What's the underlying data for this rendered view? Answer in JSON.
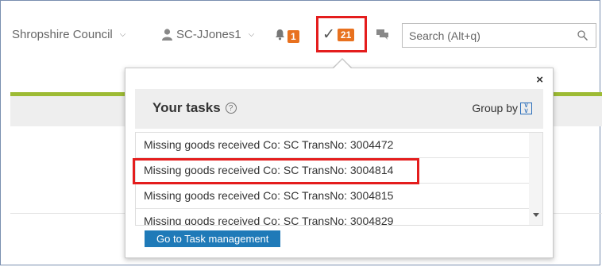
{
  "header": {
    "organisation": "Shropshire Council",
    "user": "SC-JJones1",
    "notifications_count": "1",
    "tasks_count": "21",
    "search_placeholder": "Search (Alt+q)"
  },
  "popup": {
    "title": "Your tasks",
    "group_by_label": "Group by",
    "close_label": "×",
    "tasks": [
      "Missing goods received Co: SC TransNo: 3004472",
      "Missing goods received Co: SC TransNo: 3004814",
      "Missing goods received Co: SC TransNo: 3004815",
      "Missing goods received Co: SC TransNo: 3004829"
    ],
    "task_management_button": "Go to Task management"
  },
  "colors": {
    "accent_blue": "#1f7ab8",
    "badge_orange": "#e8711f",
    "highlight_red": "#e41d1d",
    "green_bar": "#9dbb34"
  },
  "icons": {
    "user": "user-icon",
    "bell": "bell-icon",
    "tasks": "checkmark-icon",
    "chat": "chat-icon",
    "search": "search-icon",
    "help": "help-icon",
    "group": "double-chevron-down-icon"
  }
}
